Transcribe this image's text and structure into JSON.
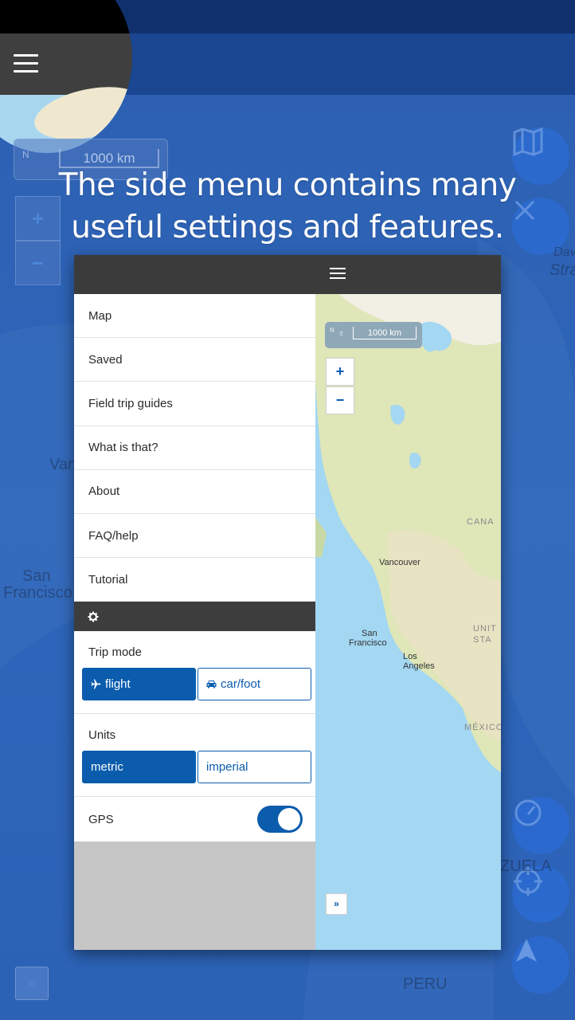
{
  "headline": {
    "line1": "The side menu contains many",
    "line2": "useful settings and features."
  },
  "background": {
    "scale_north": "N",
    "scale_label": "1000 km",
    "zoom_in": "+",
    "zoom_out": "−",
    "expand": "»",
    "labels": [
      "San",
      "Francisco",
      "Van",
      "PERU",
      "ZUELA",
      "Strai",
      "Dav"
    ]
  },
  "menu": {
    "items": [
      "Map",
      "Saved",
      "Field trip guides",
      "What is that?",
      "About",
      "FAQ/help",
      "Tutorial"
    ]
  },
  "settings": {
    "trip_mode": {
      "title": "Trip mode",
      "options": [
        "flight",
        "car/foot"
      ],
      "selected": "flight"
    },
    "units": {
      "title": "Units",
      "options": [
        "metric",
        "imperial"
      ],
      "selected": "metric"
    },
    "gps": {
      "label": "GPS",
      "enabled": true
    }
  },
  "mini_map": {
    "scale_north": "N",
    "scale_label": "1000 km",
    "zoom_in": "+",
    "zoom_out": "−",
    "expand": "»",
    "cities": {
      "vancouver": "Vancouver",
      "sf_1": "San",
      "sf_2": "Francisco",
      "la_1": "Los",
      "la_2": "Angeles"
    },
    "countries": {
      "canada": "CANA",
      "usa_1": "UNIT",
      "usa_2": "STA",
      "mexico": "MÉXICO"
    }
  },
  "colors": {
    "accent": "#0b5cad",
    "dark_bar": "#3b3b3b",
    "background_blue": "#2f63b3"
  }
}
